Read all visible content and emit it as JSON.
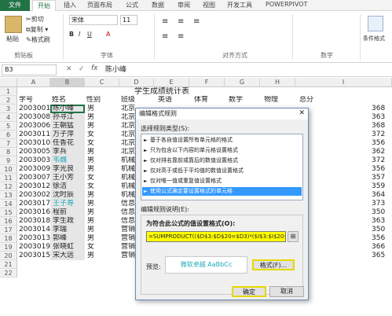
{
  "tabs": [
    "文件",
    "开始",
    "插入",
    "页面布局",
    "公式",
    "数据",
    "审阅",
    "视图",
    "开发工具",
    "POWERPIVOT"
  ],
  "ribbon": {
    "paste": "粘贴",
    "cut": "剪切",
    "copy": "复制 ▾",
    "format_painter": "格式刷",
    "clipboard_group": "剪贴板",
    "font_group": "字体",
    "align_group": "对齐方式",
    "number_group": "数字",
    "cond_format": "条件格式",
    "font_name": "宋体",
    "font_size": "11"
  },
  "formula_bar": {
    "name_box": "B3",
    "fx": "fx",
    "value": "陈小峰"
  },
  "sheet": {
    "columns": [
      "A",
      "B",
      "C",
      "D",
      "E",
      "F",
      "G",
      "H",
      "I"
    ],
    "title": "学生成绩统计表",
    "headers": [
      "学号",
      "姓名",
      "性别",
      "班级",
      "英语",
      "体育",
      "数学",
      "物理",
      "总分"
    ],
    "rows": [
      {
        "num": "3",
        "id": "2003001",
        "name": "陈小峰",
        "gender": "男",
        "cls": "北京",
        "total": "368"
      },
      {
        "num": "4",
        "id": "2003008",
        "name": "孙寻江",
        "gender": "男",
        "cls": "北京",
        "total": "363"
      },
      {
        "num": "5",
        "id": "2003006",
        "name": "王朝猛",
        "gender": "男",
        "cls": "北京",
        "total": "368"
      },
      {
        "num": "6",
        "id": "2003011",
        "name": "万子萍",
        "gender": "女",
        "cls": "北京",
        "total": "372"
      },
      {
        "num": "7",
        "id": "2003010",
        "name": "任香花",
        "gender": "女",
        "cls": "北京",
        "total": "356"
      },
      {
        "num": "8",
        "id": "2003005",
        "name": "李兵",
        "gender": "男",
        "cls": "北京",
        "total": "362"
      },
      {
        "num": "9",
        "id": "2003003",
        "name": "韦魏",
        "gender": "男",
        "cls": "机械",
        "total": "372"
      },
      {
        "num": "10",
        "id": "2003009",
        "name": "李光良",
        "gender": "男",
        "cls": "机械",
        "total": "356"
      },
      {
        "num": "11",
        "id": "2003007",
        "name": "王小芳",
        "gender": "女",
        "cls": "机械",
        "total": "357"
      },
      {
        "num": "12",
        "id": "2003012",
        "name": "徐洁",
        "gender": "女",
        "cls": "机械",
        "total": "359"
      },
      {
        "num": "13",
        "id": "2003002",
        "name": "沈时辰",
        "gender": "男",
        "cls": "机械",
        "total": "364"
      },
      {
        "num": "14",
        "id": "2003017",
        "name": "王子寿",
        "gender": "男",
        "cls": "信息",
        "total": "373"
      },
      {
        "num": "15",
        "id": "2003016",
        "name": "程前",
        "gender": "男",
        "cls": "信息",
        "total": "350"
      },
      {
        "num": "16",
        "id": "2003018",
        "name": "李生政",
        "gender": "男",
        "cls": "信息",
        "total": "363"
      },
      {
        "num": "17",
        "id": "2003014",
        "name": "李瑞",
        "gender": "男",
        "cls": "营销",
        "total": "350"
      },
      {
        "num": "18",
        "id": "2003013",
        "name": "郭峰",
        "gender": "男",
        "cls": "营销",
        "total": "356"
      },
      {
        "num": "19",
        "id": "2003019",
        "name": "张晓虹",
        "gender": "女",
        "cls": "营销",
        "total": "366"
      },
      {
        "num": "20",
        "id": "2003015",
        "name": "宋大远",
        "gender": "男",
        "cls": "营销",
        "total": "365"
      },
      {
        "num": "21",
        "id": "",
        "name": "",
        "gender": "",
        "cls": "",
        "total": ""
      },
      {
        "num": "22",
        "id": "",
        "name": "",
        "gender": "",
        "cls": "",
        "total": ""
      }
    ]
  },
  "dialog": {
    "title": "编辑格式规则",
    "rule_type_label": "选择规则类型(S):",
    "rule_types": [
      "基于各自值设置所有单元格的格式",
      "只为包含以下内容的单元格设置格式",
      "仅对排名靠前或靠后的数值设置格式",
      "仅对高于或低于平均值的数值设置格式",
      "仅对唯一值或重复值设置格式",
      "使用公式确定要设置格式的单元格"
    ],
    "edit_label": "编辑规则说明(E):",
    "formula_label": "为符合此公式的值设置格式(O):",
    "formula": "=SUMPRODUCT(($D$3:$D$20=$D3)*($I$3:$I$20>",
    "preview_label": "预览:",
    "preview_text": "微软卓越  AaBbCc",
    "format_button": "格式(F)...",
    "ok_button": "确定",
    "cancel_button": "取消"
  },
  "colors": {
    "accent": "#217346",
    "selected": "#3399ff",
    "highlight": "#ffff00",
    "teal_text": "#1fa8b8"
  }
}
